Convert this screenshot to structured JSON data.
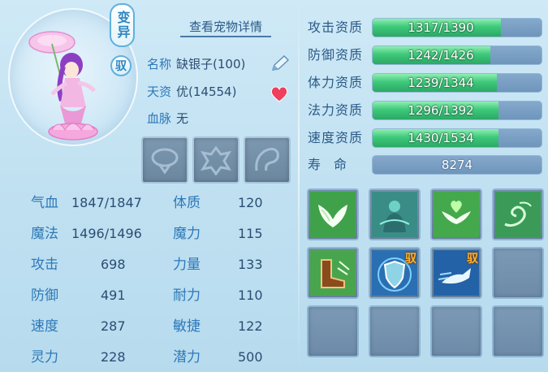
{
  "portrait": {
    "variant_tag": "变异",
    "ride_tag": "驭"
  },
  "detail_link": "查看宠物详情",
  "info": {
    "name_label": "名称",
    "name_value": "缺银子(100)",
    "talent_label": "天资",
    "talent_value": "优(14554)",
    "bloodline_label": "血脉",
    "bloodline_value": "无"
  },
  "equipment": [
    {
      "icon": "collar-slot-icon"
    },
    {
      "icon": "armor-slot-icon"
    },
    {
      "icon": "charm-slot-icon"
    }
  ],
  "stats": [
    {
      "label": "气血",
      "value": "1847/1847"
    },
    {
      "label": "体质",
      "value": "120"
    },
    {
      "label": "魔法",
      "value": "1496/1496"
    },
    {
      "label": "魔力",
      "value": "115"
    },
    {
      "label": "攻击",
      "value": "698"
    },
    {
      "label": "力量",
      "value": "133"
    },
    {
      "label": "防御",
      "value": "491"
    },
    {
      "label": "耐力",
      "value": "110"
    },
    {
      "label": "速度",
      "value": "287"
    },
    {
      "label": "敏捷",
      "value": "122"
    },
    {
      "label": "灵力",
      "value": "228"
    },
    {
      "label": "潜力",
      "value": "500"
    }
  ],
  "aptitudes": [
    {
      "label": "攻击资质",
      "text": "1317/1390",
      "current": 1317,
      "max": 1390
    },
    {
      "label": "防御资质",
      "text": "1242/1426",
      "current": 1242,
      "max": 1426
    },
    {
      "label": "体力资质",
      "text": "1239/1344",
      "current": 1239,
      "max": 1344
    },
    {
      "label": "法力资质",
      "text": "1296/1392",
      "current": 1296,
      "max": 1392
    },
    {
      "label": "速度资质",
      "text": "1430/1534",
      "current": 1430,
      "max": 1534
    }
  ],
  "lifespan": {
    "label": "寿　命",
    "value": "8274"
  },
  "skills": [
    {
      "icon": "angel-wings-icon",
      "ride": ""
    },
    {
      "icon": "spirit-silhouette-icon",
      "ride": ""
    },
    {
      "icon": "heart-wings-icon",
      "ride": ""
    },
    {
      "icon": "wind-swirl-icon",
      "ride": ""
    },
    {
      "icon": "swift-boot-icon",
      "ride": ""
    },
    {
      "icon": "shield-icon",
      "ride": "驭"
    },
    {
      "icon": "dash-figure-icon",
      "ride": "驭"
    },
    {
      "icon": "",
      "ride": ""
    },
    {
      "icon": "",
      "ride": ""
    },
    {
      "icon": "",
      "ride": ""
    },
    {
      "icon": "",
      "ride": ""
    },
    {
      "icon": "",
      "ride": ""
    }
  ],
  "colors": {
    "background": "#c4e2f2",
    "label_blue": "#2d78b8",
    "bar_green": "#3ec97a",
    "bar_track": "#7a9fc4",
    "ride_tag": "#ffb234"
  }
}
